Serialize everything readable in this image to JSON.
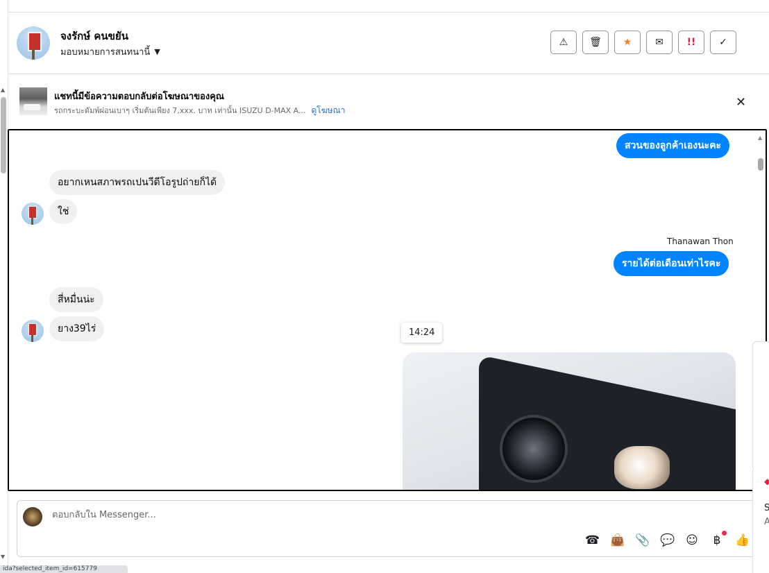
{
  "header": {
    "name": "จงรักษ์ คนขยัน",
    "assign_label": "มอบหมายการสนทนานี้",
    "actions": [
      {
        "icon": "warning-icon",
        "glyph": "⚠"
      },
      {
        "icon": "trash-icon",
        "glyph": "🗑"
      },
      {
        "icon": "star-icon",
        "glyph": "★"
      },
      {
        "icon": "envelope-icon",
        "glyph": "✉"
      },
      {
        "icon": "double-exclamation-icon",
        "glyph": "!!"
      },
      {
        "icon": "checkmark-icon",
        "glyph": "✓"
      }
    ]
  },
  "ad": {
    "title": "แชทนี้มีข้อความตอบกลับต่อโฆษณาของคุณ",
    "subtitle": "รถกระบะดัมพ์ผ่อนเบาๆ เริ่มต้นเพียง 7,xxx. บาท เท่านั้น ISUZU D-MAX A...",
    "link": "ดูโฆษณา",
    "close_glyph": "✕"
  },
  "messages": {
    "m1": "สวนของลูกค้าเองนะคะ",
    "m2": "อยากเหนสภาพรถเปนวีดีโอรูปถ่ายก็ได้",
    "m3": "ใช่",
    "sender": "Thanawan Thon",
    "m4": "รายได้ต่อเดือนเท่าไรคะ",
    "m5": "สี่หมื่นน่ะ",
    "m6": "ยาง39ไร่",
    "time": "14:24"
  },
  "composer": {
    "placeholder": "ตอบกลับใน Messenger...",
    "tools": [
      {
        "icon": "phone-add-icon",
        "glyph": "☎"
      },
      {
        "icon": "shopping-bag-icon",
        "glyph": "👜"
      },
      {
        "icon": "paperclip-icon",
        "glyph": "📎"
      },
      {
        "icon": "chat-bubble-icon",
        "glyph": "💬"
      },
      {
        "icon": "emoji-icon",
        "glyph": "☺"
      },
      {
        "icon": "baht-icon",
        "glyph": "฿"
      },
      {
        "icon": "thumbs-up-icon",
        "glyph": "👍"
      }
    ]
  },
  "side": {
    "s": "S",
    "a": "A"
  },
  "status_url": "ida?selected_item_id=615779"
}
